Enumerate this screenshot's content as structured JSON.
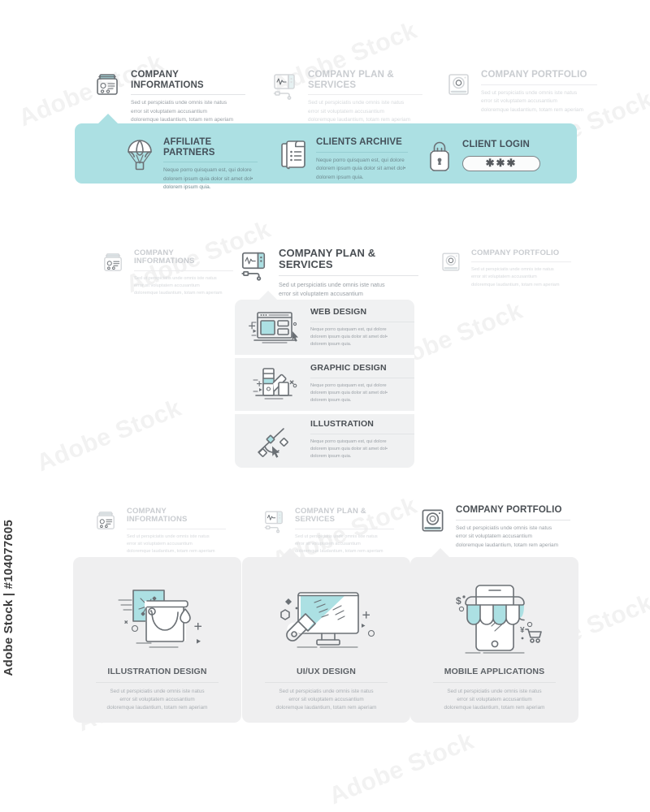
{
  "watermark": {
    "id_text": "Adobe Stock | #104077605",
    "tile_text": "Adobe Stock"
  },
  "lorem": {
    "sed": "Sed ut perspiciatis unde omnis iste natus\nerror sit voluptatem accusantium\ndoloremque laudantium, totam rem aperiam",
    "sed_l1": "Sed ut perspiciatis unde omnis iste natus",
    "sed_l2": "error sit voluptatem accusantium",
    "sed_l3": "doloremque laudantium, totam rem aperiam",
    "neque_l1": "Neque porro quisquam est, qui dolore",
    "neque_l2": "dolorem ipsum quia dolor sit amet dol•",
    "neque_l3": "dolorem ipsum quia."
  },
  "top_tabs": [
    {
      "label": "COMPANY INFORMATIONS",
      "icon": "id-card-icon",
      "state": "active"
    },
    {
      "label": "COMPANY PLAN & SERVICES",
      "icon": "monitor-pulse-icon",
      "state": "dim"
    },
    {
      "label": "COMPANY PORTFOLIO",
      "icon": "camera-icon",
      "state": "dim"
    }
  ],
  "banner": {
    "color": "#ace0e3",
    "items": [
      {
        "label": "AFFILIATE PARTNERS",
        "icon": "parachute-icon"
      },
      {
        "label": "CLIENTS ARCHIVE",
        "icon": "document-list-icon"
      },
      {
        "label": "CLIENT LOGIN",
        "icon": "padlock-icon",
        "password_value": "✱✱✱"
      }
    ]
  },
  "mid_tabs": [
    {
      "label": "COMPANY INFORMATIONS",
      "icon": "id-card-icon",
      "state": "dim"
    },
    {
      "label": "COMPANY PLAN & SERVICES",
      "icon": "monitor-pulse-icon",
      "state": "active"
    },
    {
      "label": "COMPANY PORTFOLIO",
      "icon": "camera-icon",
      "state": "dim"
    }
  ],
  "services_panel": {
    "color": "#f0f1f2",
    "items": [
      {
        "label": "WEB DESIGN",
        "icon": "browser-window-icon"
      },
      {
        "label": "GRAPHIC DESIGN",
        "icon": "color-swatch-icon"
      },
      {
        "label": "ILLUSTRATION",
        "icon": "pen-tool-icon"
      }
    ]
  },
  "bottom_tabs": [
    {
      "label": "COMPANY INFORMATIONS",
      "icon": "id-card-icon",
      "state": "dim"
    },
    {
      "label": "COMPANY PLAN & SERVICES",
      "icon": "monitor-pulse-icon",
      "state": "dim"
    },
    {
      "label": "COMPANY PORTFOLIO",
      "icon": "camera-icon",
      "state": "active"
    }
  ],
  "portfolio_cards": [
    {
      "label": "ILLUSTRATION DESIGN",
      "icon": "paint-bucket-icon"
    },
    {
      "label": "UI/UX DESIGN",
      "icon": "monitor-brush-icon"
    },
    {
      "label": "MOBILE APPLICATIONS",
      "icon": "mobile-shop-icon"
    }
  ]
}
